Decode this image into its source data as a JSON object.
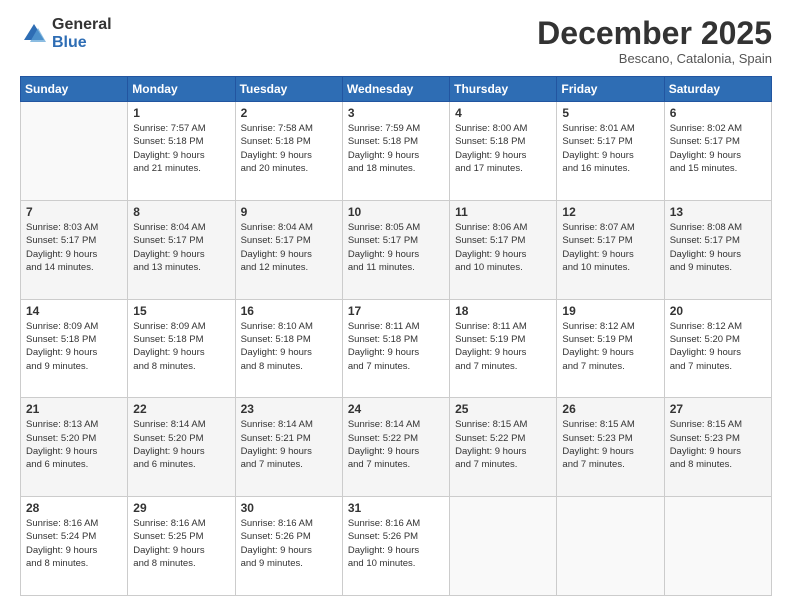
{
  "logo": {
    "general": "General",
    "blue": "Blue"
  },
  "header": {
    "month": "December 2025",
    "location": "Bescano, Catalonia, Spain"
  },
  "days_header": [
    "Sunday",
    "Monday",
    "Tuesday",
    "Wednesday",
    "Thursday",
    "Friday",
    "Saturday"
  ],
  "weeks": [
    [
      {
        "day": "",
        "info": ""
      },
      {
        "day": "1",
        "info": "Sunrise: 7:57 AM\nSunset: 5:18 PM\nDaylight: 9 hours\nand 21 minutes."
      },
      {
        "day": "2",
        "info": "Sunrise: 7:58 AM\nSunset: 5:18 PM\nDaylight: 9 hours\nand 20 minutes."
      },
      {
        "day": "3",
        "info": "Sunrise: 7:59 AM\nSunset: 5:18 PM\nDaylight: 9 hours\nand 18 minutes."
      },
      {
        "day": "4",
        "info": "Sunrise: 8:00 AM\nSunset: 5:18 PM\nDaylight: 9 hours\nand 17 minutes."
      },
      {
        "day": "5",
        "info": "Sunrise: 8:01 AM\nSunset: 5:17 PM\nDaylight: 9 hours\nand 16 minutes."
      },
      {
        "day": "6",
        "info": "Sunrise: 8:02 AM\nSunset: 5:17 PM\nDaylight: 9 hours\nand 15 minutes."
      }
    ],
    [
      {
        "day": "7",
        "info": "Sunrise: 8:03 AM\nSunset: 5:17 PM\nDaylight: 9 hours\nand 14 minutes."
      },
      {
        "day": "8",
        "info": "Sunrise: 8:04 AM\nSunset: 5:17 PM\nDaylight: 9 hours\nand 13 minutes."
      },
      {
        "day": "9",
        "info": "Sunrise: 8:04 AM\nSunset: 5:17 PM\nDaylight: 9 hours\nand 12 minutes."
      },
      {
        "day": "10",
        "info": "Sunrise: 8:05 AM\nSunset: 5:17 PM\nDaylight: 9 hours\nand 11 minutes."
      },
      {
        "day": "11",
        "info": "Sunrise: 8:06 AM\nSunset: 5:17 PM\nDaylight: 9 hours\nand 10 minutes."
      },
      {
        "day": "12",
        "info": "Sunrise: 8:07 AM\nSunset: 5:17 PM\nDaylight: 9 hours\nand 10 minutes."
      },
      {
        "day": "13",
        "info": "Sunrise: 8:08 AM\nSunset: 5:17 PM\nDaylight: 9 hours\nand 9 minutes."
      }
    ],
    [
      {
        "day": "14",
        "info": "Sunrise: 8:09 AM\nSunset: 5:18 PM\nDaylight: 9 hours\nand 9 minutes."
      },
      {
        "day": "15",
        "info": "Sunrise: 8:09 AM\nSunset: 5:18 PM\nDaylight: 9 hours\nand 8 minutes."
      },
      {
        "day": "16",
        "info": "Sunrise: 8:10 AM\nSunset: 5:18 PM\nDaylight: 9 hours\nand 8 minutes."
      },
      {
        "day": "17",
        "info": "Sunrise: 8:11 AM\nSunset: 5:18 PM\nDaylight: 9 hours\nand 7 minutes."
      },
      {
        "day": "18",
        "info": "Sunrise: 8:11 AM\nSunset: 5:19 PM\nDaylight: 9 hours\nand 7 minutes."
      },
      {
        "day": "19",
        "info": "Sunrise: 8:12 AM\nSunset: 5:19 PM\nDaylight: 9 hours\nand 7 minutes."
      },
      {
        "day": "20",
        "info": "Sunrise: 8:12 AM\nSunset: 5:20 PM\nDaylight: 9 hours\nand 7 minutes."
      }
    ],
    [
      {
        "day": "21",
        "info": "Sunrise: 8:13 AM\nSunset: 5:20 PM\nDaylight: 9 hours\nand 6 minutes."
      },
      {
        "day": "22",
        "info": "Sunrise: 8:14 AM\nSunset: 5:20 PM\nDaylight: 9 hours\nand 6 minutes."
      },
      {
        "day": "23",
        "info": "Sunrise: 8:14 AM\nSunset: 5:21 PM\nDaylight: 9 hours\nand 7 minutes."
      },
      {
        "day": "24",
        "info": "Sunrise: 8:14 AM\nSunset: 5:22 PM\nDaylight: 9 hours\nand 7 minutes."
      },
      {
        "day": "25",
        "info": "Sunrise: 8:15 AM\nSunset: 5:22 PM\nDaylight: 9 hours\nand 7 minutes."
      },
      {
        "day": "26",
        "info": "Sunrise: 8:15 AM\nSunset: 5:23 PM\nDaylight: 9 hours\nand 7 minutes."
      },
      {
        "day": "27",
        "info": "Sunrise: 8:15 AM\nSunset: 5:23 PM\nDaylight: 9 hours\nand 8 minutes."
      }
    ],
    [
      {
        "day": "28",
        "info": "Sunrise: 8:16 AM\nSunset: 5:24 PM\nDaylight: 9 hours\nand 8 minutes."
      },
      {
        "day": "29",
        "info": "Sunrise: 8:16 AM\nSunset: 5:25 PM\nDaylight: 9 hours\nand 8 minutes."
      },
      {
        "day": "30",
        "info": "Sunrise: 8:16 AM\nSunset: 5:26 PM\nDaylight: 9 hours\nand 9 minutes."
      },
      {
        "day": "31",
        "info": "Sunrise: 8:16 AM\nSunset: 5:26 PM\nDaylight: 9 hours\nand 10 minutes."
      },
      {
        "day": "",
        "info": ""
      },
      {
        "day": "",
        "info": ""
      },
      {
        "day": "",
        "info": ""
      }
    ]
  ]
}
